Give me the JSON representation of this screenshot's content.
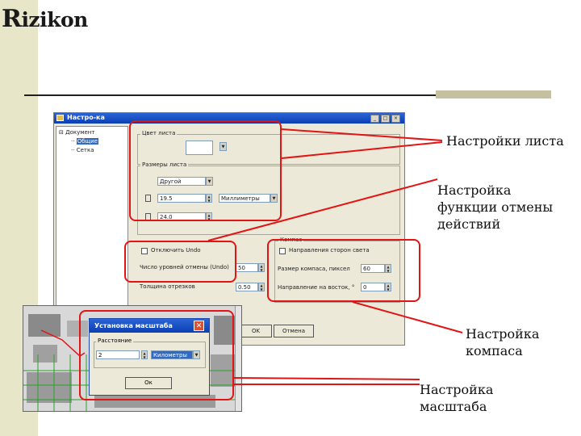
{
  "logo": {
    "initial": "R",
    "rest": "izikon"
  },
  "callouts": {
    "sheet": "Настройки листа",
    "undo": [
      "Настройка",
      "функции отмены",
      "действий"
    ],
    "compass": [
      "Настройка",
      "компаса"
    ],
    "scale": [
      "Настройка",
      "масштаба"
    ]
  },
  "window": {
    "title": "Настро-ка",
    "buttons": {
      "min": "_",
      "max": "□",
      "close": "×"
    },
    "tree": {
      "root": "Документ",
      "children": [
        "Общие",
        "Сетка"
      ]
    },
    "sheet_color": {
      "group": "Цвет листа"
    },
    "sheet_size": {
      "group": "Размеры листа",
      "preset": "Другой",
      "width": "19.5",
      "height": "24.0",
      "units": "Миллиметры"
    },
    "undo": {
      "checkbox": "Отключить Undo",
      "levels_label": "Число уровней отмены (Undo)",
      "levels_value": "50",
      "line_label": "Толщина отрезков",
      "line_value": "0.50"
    },
    "compass": {
      "group": "Компас",
      "checkbox": "Направления сторон света",
      "size_label": "Размер компаса, пиксел",
      "size_value": "60",
      "angle_label": "Направление на восток, °",
      "angle_value": "0"
    },
    "ok": "OK",
    "cancel": "Отмена"
  },
  "scale_dialog": {
    "title": "Установка масштаба",
    "group": "Расстояние",
    "value": "2",
    "units": "Километры",
    "ok": "Ок"
  },
  "colors": {
    "accent_red": "#e21414",
    "titlebar_blue": "#0a3fb3",
    "sidebar": "#e8e6c9"
  }
}
